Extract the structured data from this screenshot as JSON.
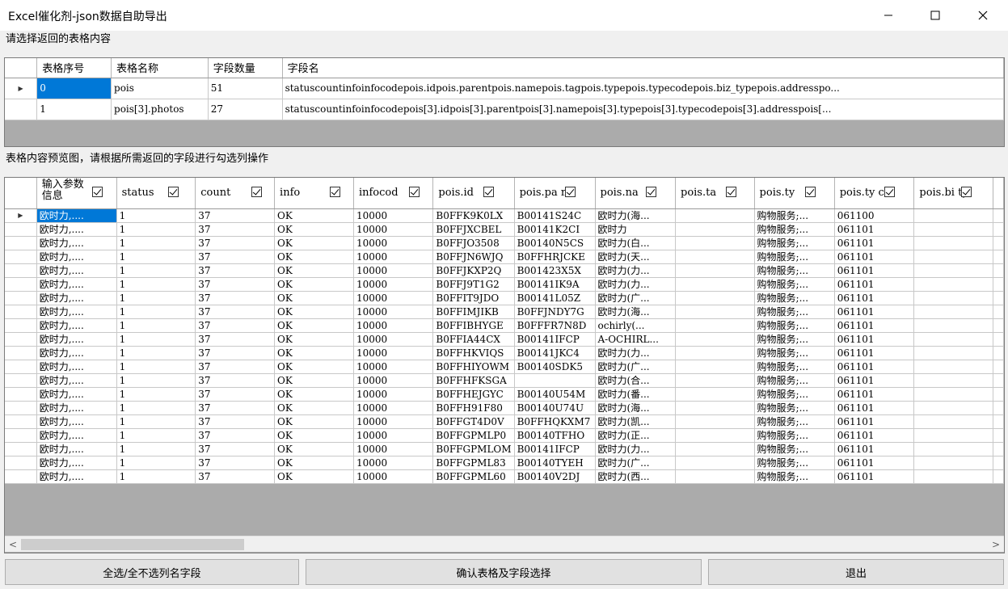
{
  "window": {
    "title": "Excel催化剂-json数据自助导出"
  },
  "labels": {
    "top": "请选择返回的表格内容",
    "middle": "表格内容预览图，请根据所需返回的字段进行勾选列操作"
  },
  "table1": {
    "headers": [
      "表格序号",
      "表格名称",
      "字段数量",
      "字段名"
    ],
    "rows": [
      [
        "0",
        "pois",
        "51",
        "statuscountinfoinfocodepois.idpois.parentpois.namepois.tagpois.typepois.typecodepois.biz_typepois.addresspo..."
      ],
      [
        "1",
        "pois[3].photos",
        "27",
        "statuscountinfoinfocodepois[3].idpois[3].parentpois[3].namepois[3].typepois[3].typecodepois[3].addresspois[..."
      ]
    ]
  },
  "table2": {
    "headers": [
      "输入参数信息",
      "status",
      "count",
      "info",
      "infocod",
      "pois.id",
      "pois.parent",
      "pois.na",
      "pois.ta",
      "pois.ty",
      "pois.typeco",
      "pois.biz_ty"
    ],
    "header_lines": [
      [
        "输入参数",
        "信息"
      ]
    ],
    "header_visible": [
      "输入参数信息",
      "status",
      "count",
      "info",
      "infocod",
      "pois.id",
      "pois.pa nt",
      "pois.na",
      "pois.ta",
      "pois.ty",
      "pois.ty co",
      "pois.bi ty"
    ],
    "rows": [
      [
        "欧时力,....",
        "1",
        "37",
        "OK",
        "10000",
        "B0FFK9K0LX",
        "B00141S24C",
        "欧时力(海...",
        "",
        "购物服务;...",
        "061100",
        ""
      ],
      [
        "欧时力,....",
        "1",
        "37",
        "OK",
        "10000",
        "B0FFJXCBEL",
        "B00141K2CI",
        "欧时力",
        "",
        "购物服务;...",
        "061101",
        ""
      ],
      [
        "欧时力,....",
        "1",
        "37",
        "OK",
        "10000",
        "B0FFJO3508",
        "B00140N5CS",
        "欧时力(白...",
        "",
        "购物服务;...",
        "061101",
        ""
      ],
      [
        "欧时力,....",
        "1",
        "37",
        "OK",
        "10000",
        "B0FFJN6WJQ",
        "B0FFHRJCKE",
        "欧时力(天...",
        "",
        "购物服务;...",
        "061101",
        ""
      ],
      [
        "欧时力,....",
        "1",
        "37",
        "OK",
        "10000",
        "B0FFJKXP2Q",
        "B001423X5X",
        "欧时力(力...",
        "",
        "购物服务;...",
        "061101",
        ""
      ],
      [
        "欧时力,....",
        "1",
        "37",
        "OK",
        "10000",
        "B0FFJ9T1G2",
        "B00141IK9A",
        "欧时力(力...",
        "",
        "购物服务;...",
        "061101",
        ""
      ],
      [
        "欧时力,....",
        "1",
        "37",
        "OK",
        "10000",
        "B0FFIT9JDO",
        "B00141L05Z",
        "欧时力(广...",
        "",
        "购物服务;...",
        "061101",
        ""
      ],
      [
        "欧时力,....",
        "1",
        "37",
        "OK",
        "10000",
        "B0FFIMJIKB",
        "B0FFJNDY7G",
        "欧时力(海...",
        "",
        "购物服务;...",
        "061101",
        ""
      ],
      [
        "欧时力,....",
        "1",
        "37",
        "OK",
        "10000",
        "B0FFIBHYGE",
        "B0FFFR7N8D",
        "ochirly(...",
        "",
        "购物服务;...",
        "061101",
        ""
      ],
      [
        "欧时力,....",
        "1",
        "37",
        "OK",
        "10000",
        "B0FFIA44CX",
        "B00141IFCP",
        "A-OCHIRL...",
        "",
        "购物服务;...",
        "061101",
        ""
      ],
      [
        "欧时力,....",
        "1",
        "37",
        "OK",
        "10000",
        "B0FFHKVIQS",
        "B00141JKC4",
        "欧时力(力...",
        "",
        "购物服务;...",
        "061101",
        ""
      ],
      [
        "欧时力,....",
        "1",
        "37",
        "OK",
        "10000",
        "B0FFHIYOWM",
        "B00140SDK5",
        "欧时力(广...",
        "",
        "购物服务;...",
        "061101",
        ""
      ],
      [
        "欧时力,....",
        "1",
        "37",
        "OK",
        "10000",
        "B0FFHFKSGA",
        "",
        "欧时力(合...",
        "",
        "购物服务;...",
        "061101",
        ""
      ],
      [
        "欧时力,....",
        "1",
        "37",
        "OK",
        "10000",
        "B0FFHEJGYC",
        "B00140U54M",
        "欧时力(番...",
        "",
        "购物服务;...",
        "061101",
        ""
      ],
      [
        "欧时力,....",
        "1",
        "37",
        "OK",
        "10000",
        "B0FFH91F80",
        "B00140U74U",
        "欧时力(海...",
        "",
        "购物服务;...",
        "061101",
        ""
      ],
      [
        "欧时力,....",
        "1",
        "37",
        "OK",
        "10000",
        "B0FFGT4D0V",
        "B0FFHQKXM7",
        "欧时力(凯...",
        "",
        "购物服务;...",
        "061101",
        ""
      ],
      [
        "欧时力,....",
        "1",
        "37",
        "OK",
        "10000",
        "B0FFGPMLP0",
        "B00140TFHO",
        "欧时力(正...",
        "",
        "购物服务;...",
        "061101",
        ""
      ],
      [
        "欧时力,....",
        "1",
        "37",
        "OK",
        "10000",
        "B0FFGPMLOM",
        "B00141IFCP",
        "欧时力(力...",
        "",
        "购物服务;...",
        "061101",
        ""
      ],
      [
        "欧时力,....",
        "1",
        "37",
        "OK",
        "10000",
        "B0FFGPML83",
        "B00140TYEH",
        "欧时力(广...",
        "",
        "购物服务;...",
        "061101",
        ""
      ],
      [
        "欧时力,....",
        "1",
        "37",
        "OK",
        "10000",
        "B0FFGPML60",
        "B00140V2DJ",
        "欧时力(西...",
        "",
        "购物服务;...",
        "061101",
        ""
      ]
    ]
  },
  "buttons": {
    "select_all": "全选/全不选列名字段",
    "confirm": "确认表格及字段选择",
    "exit": "退出"
  },
  "colors": {
    "selection": "#0078d7",
    "grid_bg": "#ababab"
  }
}
